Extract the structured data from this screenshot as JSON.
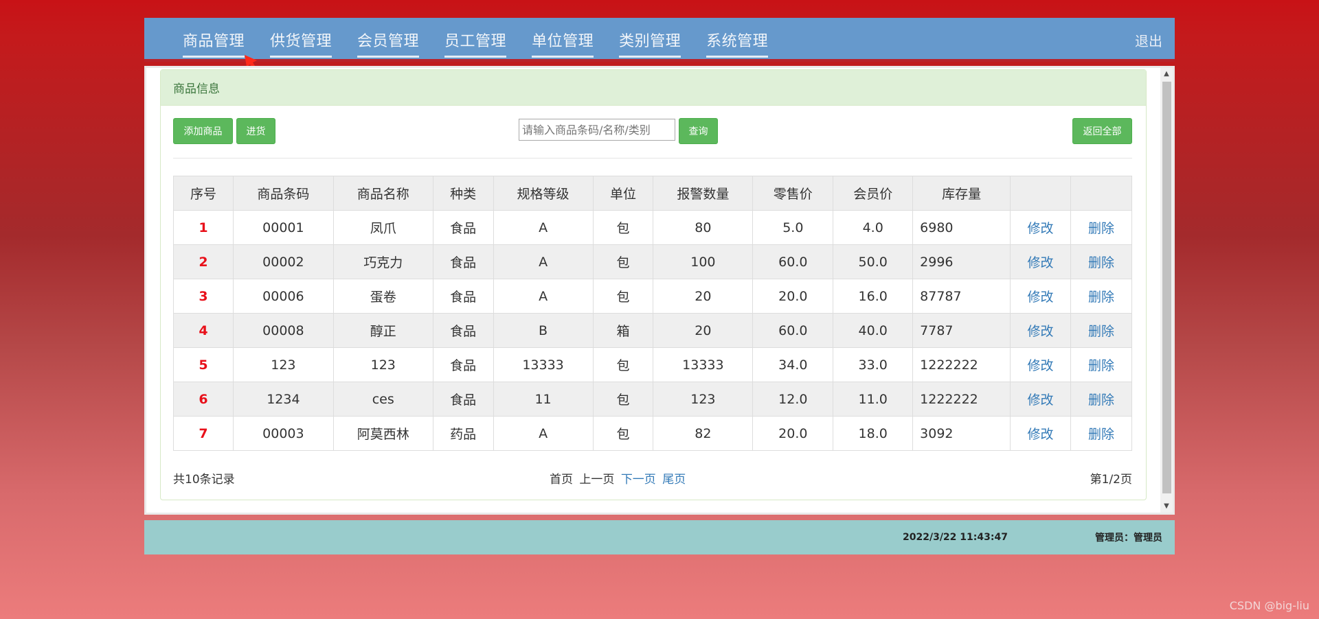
{
  "nav": {
    "items": [
      "商品管理",
      "供货管理",
      "会员管理",
      "员工管理",
      "单位管理",
      "类别管理",
      "系统管理"
    ],
    "logout": "退出"
  },
  "panel": {
    "title": "商品信息"
  },
  "toolbar": {
    "add_label": "添加商品",
    "stock_in_label": "进货",
    "search_placeholder": "请输入商品条码/名称/类别",
    "query_label": "查询",
    "back_all_label": "返回全部"
  },
  "table": {
    "headers": [
      "序号",
      "商品条码",
      "商品名称",
      "种类",
      "规格等级",
      "单位",
      "报警数量",
      "零售价",
      "会员价",
      "库存量",
      "",
      ""
    ],
    "rows": [
      {
        "no": "1",
        "barcode": "00001",
        "name": "凤爪",
        "category": "食品",
        "grade": "A",
        "unit": "包",
        "alarm": "80",
        "retail": "5.0",
        "member": "4.0",
        "stock": "6980",
        "edit": "修改",
        "delete": "删除"
      },
      {
        "no": "2",
        "barcode": "00002",
        "name": "巧克力",
        "category": "食品",
        "grade": "A",
        "unit": "包",
        "alarm": "100",
        "retail": "60.0",
        "member": "50.0",
        "stock": "2996",
        "edit": "修改",
        "delete": "删除"
      },
      {
        "no": "3",
        "barcode": "00006",
        "name": "蛋卷",
        "category": "食品",
        "grade": "A",
        "unit": "包",
        "alarm": "20",
        "retail": "20.0",
        "member": "16.0",
        "stock": "87787",
        "edit": "修改",
        "delete": "删除"
      },
      {
        "no": "4",
        "barcode": "00008",
        "name": "醇正",
        "category": "食品",
        "grade": "B",
        "unit": "箱",
        "alarm": "20",
        "retail": "60.0",
        "member": "40.0",
        "stock": "7787",
        "edit": "修改",
        "delete": "删除"
      },
      {
        "no": "5",
        "barcode": "123",
        "name": "123",
        "category": "食品",
        "grade": "13333",
        "unit": "包",
        "alarm": "13333",
        "retail": "34.0",
        "member": "33.0",
        "stock": "1222222",
        "edit": "修改",
        "delete": "删除"
      },
      {
        "no": "6",
        "barcode": "1234",
        "name": "ces",
        "category": "食品",
        "grade": "11",
        "unit": "包",
        "alarm": "123",
        "retail": "12.0",
        "member": "11.0",
        "stock": "1222222",
        "edit": "修改",
        "delete": "删除"
      },
      {
        "no": "7",
        "barcode": "00003",
        "name": "阿莫西林",
        "category": "药品",
        "grade": "A",
        "unit": "包",
        "alarm": "82",
        "retail": "20.0",
        "member": "18.0",
        "stock": "3092",
        "edit": "修改",
        "delete": "删除"
      }
    ]
  },
  "pagination": {
    "record_count": "共10条记录",
    "first": "首页",
    "prev": "上一页",
    "next": "下一页",
    "last": "尾页",
    "page_info": "第1/2页"
  },
  "status": {
    "datetime": "2022/3/22 11:43:47",
    "admin": "管理员：管理员"
  },
  "watermark": "CSDN @big-liu",
  "colors": {
    "nav_bg": "#6699cc",
    "btn_green": "#5cb85c",
    "panel_heading_bg": "#dff0d8",
    "row_number_red": "#e8101a",
    "link_blue": "#337ab7",
    "statusbar_bg": "#99cccc"
  }
}
